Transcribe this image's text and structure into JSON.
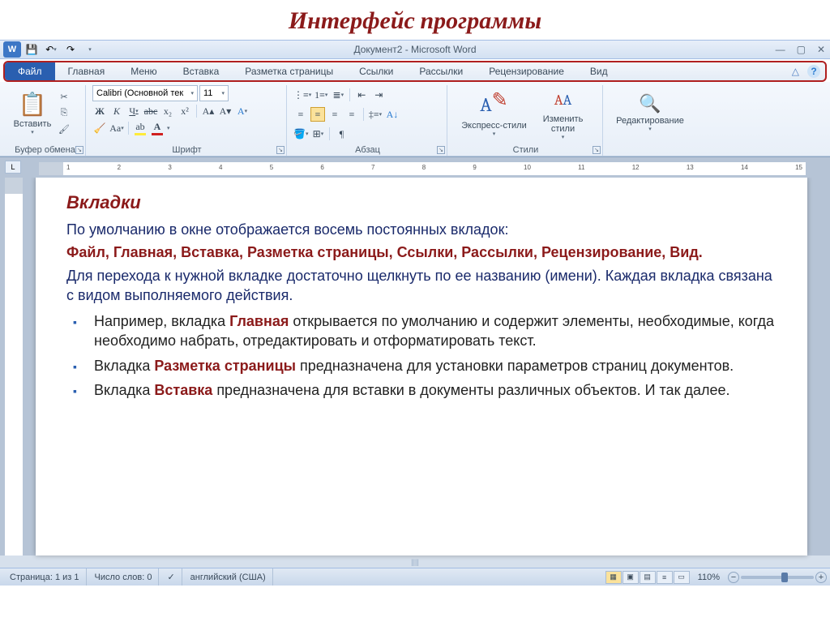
{
  "pageHeading": "Интерфейс программы",
  "windowTitle": "Документ2 - Microsoft Word",
  "tabs": {
    "file": "Файл",
    "home": "Главная",
    "menu": "Меню",
    "insert": "Вставка",
    "layout": "Разметка страницы",
    "refs": "Ссылки",
    "mailings": "Рассылки",
    "review": "Рецензирование",
    "view": "Вид"
  },
  "ribbon": {
    "clipboard": {
      "label": "Буфер обмена",
      "paste": "Вставить"
    },
    "font": {
      "label": "Шрифт",
      "name": "Calibri (Основной тек",
      "size": "11",
      "bold": "Ж",
      "italic": "К",
      "underline": "Ч"
    },
    "paragraph": {
      "label": "Абзац"
    },
    "styles": {
      "label": "Стили",
      "quick": "Экспресс-стили",
      "change": "Изменить стили"
    },
    "editing": {
      "label": "Редактирование"
    }
  },
  "document": {
    "heading": "Вкладки",
    "p1a": "По умолчанию в окне отображается восемь постоянных вкладок:",
    "p1b": "Файл,   Главная,   Вставка,   Разметка страницы,   Ссылки,   Рассылки, Рецензирование,   Вид.",
    "p2": "Для перехода к нужной вкладке достаточно щелкнуть по ее названию (имени). Каждая вкладка связана с видом выполняемого действия.",
    "li1a": "Например, вкладка ",
    "li1b": "Главная",
    "li1c": " открывается по умолчанию  и содержит элементы, необходимые, когда необходимо набрать, отредактировать и отформатировать текст.",
    "li2a": "Вкладка ",
    "li2b": "Разметка страницы",
    "li2c": " предназначена для установки параметров страниц документов.",
    "li3a": " Вкладка ",
    "li3b": "Вставка",
    "li3c": " предназначена для вставки в документы различных объектов. И так далее."
  },
  "status": {
    "page": "Страница: 1 из 1",
    "words": "Число слов: 0",
    "lang": "английский (США)",
    "zoom": "110%"
  }
}
